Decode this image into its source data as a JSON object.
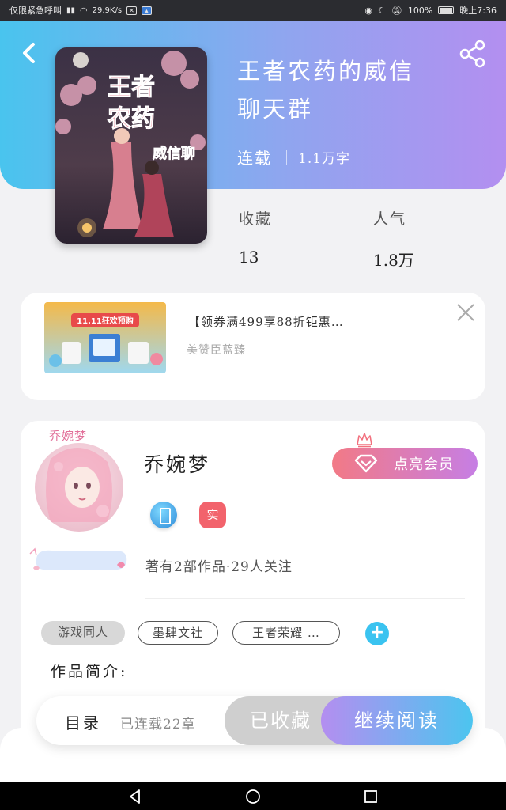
{
  "status_bar": {
    "left_text": "仅限紧急呼叫",
    "speed": "29.9K/s",
    "battery": "100%",
    "time": "晚上7:36"
  },
  "book": {
    "title_line1": "王者农药的威信",
    "title_line2": "聊天群",
    "status": "连载",
    "words": "1.1万字",
    "collect_label": "收藏",
    "collect_value": "13",
    "popularity_label": "人气",
    "popularity_value": "1.8万",
    "cover_text": "王者农药的威信聊天群"
  },
  "ad": {
    "title": "【领券满499享88折钜惠…",
    "source": "美赞臣蓝臻",
    "banner_text": "11.11狂欢预购"
  },
  "author": {
    "name": "乔婉梦",
    "real_badge": "实",
    "vip_label": "点亮会员",
    "name_tag": "乔婉梦",
    "works_info": "著有2部作品·29人关注",
    "tags": [
      "游戏同人",
      "墨肆文社",
      "王者荣耀 …"
    ],
    "add_tag": "+",
    "intro_label": "作品简介:"
  },
  "action_bar": {
    "toc_label": "目录",
    "chapters": "已连载22章",
    "collected_label": "已收藏",
    "read_label": "继续阅读"
  },
  "colors": {
    "header_start": "#49c4ee",
    "header_end": "#b38ff0",
    "vip_start": "#f27a86",
    "vip_end": "#c67ee4",
    "accent_blue": "#3ac3f0"
  }
}
